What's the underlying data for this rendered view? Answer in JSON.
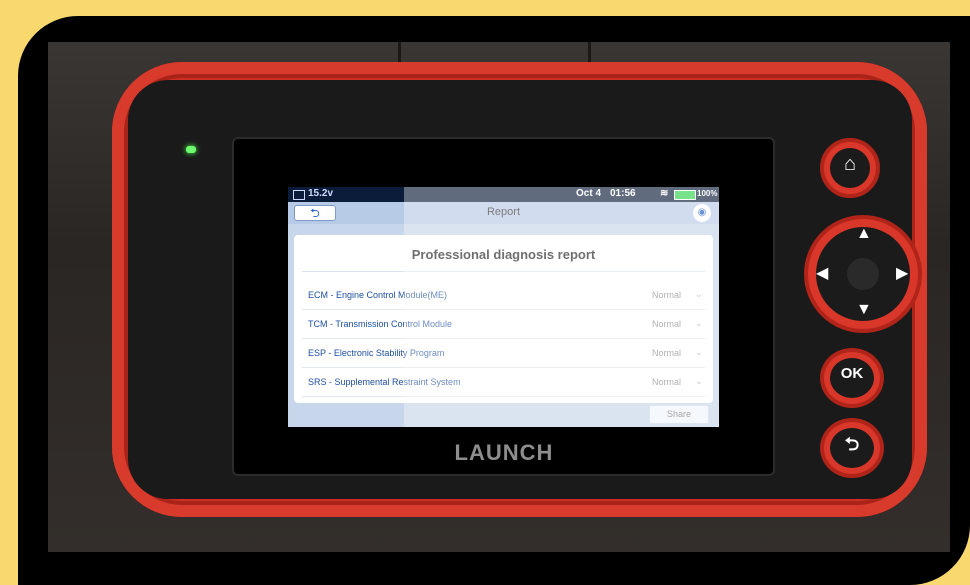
{
  "status_bar": {
    "voltage": "15.2v",
    "date": "Oct 4",
    "time": "01:56",
    "battery_percent": "100%"
  },
  "header": {
    "title": "Report"
  },
  "report": {
    "title": "Professional diagnosis report",
    "rows": [
      {
        "name": "ECM - Engine Control Module(ME)",
        "status": "Normal"
      },
      {
        "name": "TCM - Transmission Control Module",
        "status": "Normal"
      },
      {
        "name": "ESP - Electronic Stability Program",
        "status": "Normal"
      },
      {
        "name": "SRS - Supplemental Restraint System",
        "status": "Normal"
      }
    ]
  },
  "footer": {
    "share_label": "Share"
  },
  "device": {
    "brand": "LAUNCH",
    "ok_label": "OK"
  },
  "icons": [
    "back-arrow-icon",
    "camera-icon",
    "wifi-icon",
    "battery-icon",
    "home-icon",
    "return-icon"
  ],
  "colors": {
    "device_body": "#cf2f22",
    "background": "#f9d86e",
    "statusbar": "#0b1c3a",
    "link_text": "#1e4fa1"
  }
}
